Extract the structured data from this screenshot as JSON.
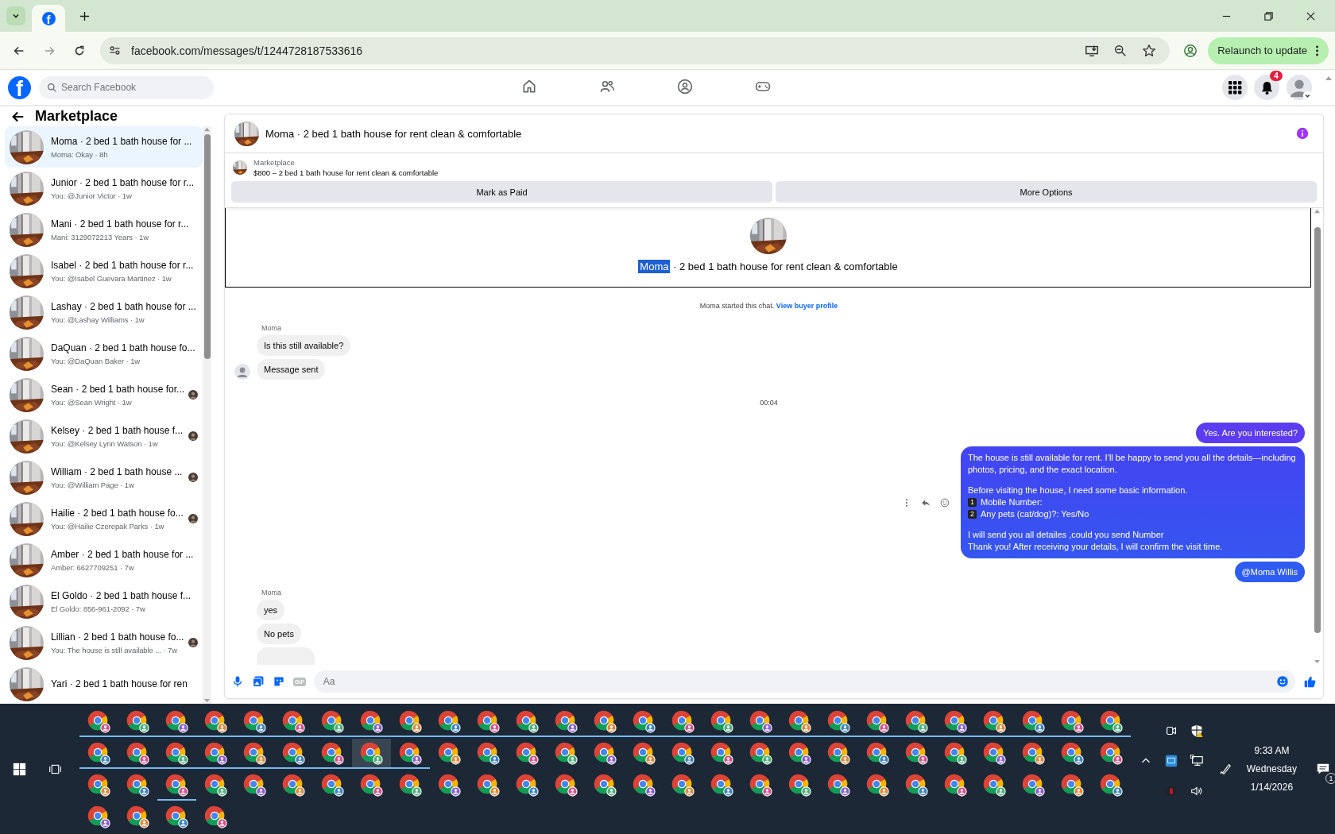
{
  "browser": {
    "favicon_letter": "f",
    "url": "facebook.com/messages/t/1244728187533616",
    "relaunch": "Relaunch to update"
  },
  "facebook": {
    "logo_letter": "f",
    "search": {
      "placeholder": "Search Facebook"
    },
    "nav": [
      {
        "selected": false
      },
      {
        "selected": false
      },
      {
        "selected": false
      },
      {
        "selected": false
      }
    ],
    "notifications": "4"
  },
  "sidebar": {
    "title": "Marketplace",
    "items": [
      {
        "title": "Moma · 2 bed 1 bath house for ...",
        "subtitle": "Moma: Okay · 8h",
        "selected": true,
        "seen": false
      },
      {
        "title": "Junior · 2 bed 1 bath house for r...",
        "subtitle": "You: @Junior Victor · 1w",
        "selected": false,
        "seen": false
      },
      {
        "title": "Mani · 2 bed 1 bath house for r...",
        "subtitle": "Mani: 3129072213 Years · 1w",
        "selected": false,
        "seen": false
      },
      {
        "title": "Isabel · 2 bed 1 bath house for r...",
        "subtitle": "You: @Isabel Guevara Martinez · 1w",
        "selected": false,
        "seen": false
      },
      {
        "title": "Lashay · 2 bed 1 bath house for ...",
        "subtitle": "You: @Lashay Williams · 1w",
        "selected": false,
        "seen": false
      },
      {
        "title": "DaQuan · 2 bed 1 bath house fo...",
        "subtitle": "You: @DaQuan Baker · 1w",
        "selected": false,
        "seen": false
      },
      {
        "title": "Sean · 2 bed 1 bath house for...",
        "subtitle": "You: @Sean Wright · 1w",
        "selected": false,
        "seen": true
      },
      {
        "title": "Kelsey · 2 bed 1 bath house f...",
        "subtitle": "You: @Kelsey Lynn Watson · 1w",
        "selected": false,
        "seen": true
      },
      {
        "title": "William · 2 bed 1 bath house ...",
        "subtitle": "You: @William Page · 1w",
        "selected": false,
        "seen": true
      },
      {
        "title": "Hailie · 2 bed 1 bath house fo...",
        "subtitle": "You: @Hailie Czerepak Parks · 1w",
        "selected": false,
        "seen": true
      },
      {
        "title": "Amber · 2 bed 1 bath house for ...",
        "subtitle": "Amber: 6627709251 · 7w",
        "selected": false,
        "seen": false
      },
      {
        "title": "El Goldo · 2 bed 1 bath house f...",
        "subtitle": "El Goldo: 856-961-2092 · 7w",
        "selected": false,
        "seen": false
      },
      {
        "title": "Lillian · 2 bed 1 bath house fo...",
        "subtitle": "You: The house is still available ... · 7w",
        "selected": false,
        "seen": true
      },
      {
        "title": "Yari · 2 bed 1 bath house for ren",
        "selected": false,
        "seen": false
      }
    ]
  },
  "chat": {
    "title": "Moma · 2 bed 1 bath house for rent clean & comfortable",
    "marketplace": {
      "label": "Marketplace",
      "listing": "$800 – 2 bed 1 bath house for rent clean & comfortable"
    },
    "buttons": [
      "Mark as Paid",
      "More Options"
    ],
    "intro_title": [
      {
        "text": "Moma",
        "selected": true
      },
      {
        "text": " · 2 bed 1 bath house for rent clean & comfortable",
        "selected": false
      }
    ],
    "started": "Moma started this chat.",
    "profile_link": "View buyer profile",
    "messages": [
      {
        "kind": "sender",
        "text": "Moma"
      },
      {
        "kind": "incoming",
        "text": "Is this still available?",
        "avatar": false
      },
      {
        "kind": "incoming",
        "text": "Message sent",
        "avatar": true
      },
      {
        "kind": "time",
        "text": "00:04"
      },
      {
        "kind": "outgoing",
        "text": "Yes. Are you interested?",
        "color": "#5b3cf0"
      },
      {
        "kind": "long",
        "color": "#4444f2",
        "paragraphs": [
          [
            {
              "text": "The house is still available for rent. I’ll be happy to send you all the details—including photos, pricing, and the exact location."
            }
          ],
          [
            {
              "text": "Before visiting the house, I need some basic information."
            },
            {
              "keycap": "1",
              "text": " Mobile Number:"
            },
            {
              "keycap": "2",
              "text": "Any pets (cat/dog)?: Yes/No"
            }
          ],
          [
            {
              "text": "I will send you all detailes ,could you send Number"
            },
            {
              "text": "Thank you! After receiving your details, I will confirm the visit time."
            }
          ]
        ]
      },
      {
        "kind": "outgoing",
        "text": "@Moma Willis",
        "color": "#2f5cf0"
      },
      {
        "kind": "sender",
        "text": "Moma"
      },
      {
        "kind": "incoming",
        "text": "yes",
        "avatar": false
      },
      {
        "kind": "incoming",
        "text": "No pets",
        "avatar": false
      },
      {
        "kind": "clipped"
      }
    ],
    "composer": {
      "gif": "GIF",
      "placeholder": "Aa"
    }
  },
  "taskbar": {
    "app_rows": [
      [
        {
          "running": true,
          "selected": false
        },
        {
          "running": true,
          "selected": false
        },
        {
          "running": true,
          "selected": false
        },
        {
          "running": true,
          "selected": false
        },
        {
          "running": true,
          "selected": false
        },
        {
          "running": true,
          "selected": false
        },
        {
          "running": true,
          "selected": false
        },
        {
          "running": true,
          "selected": false
        },
        {
          "running": true,
          "selected": false
        },
        {
          "running": true,
          "selected": false
        },
        {
          "running": true,
          "selected": false
        },
        {
          "running": true,
          "selected": false
        },
        {
          "running": true,
          "selected": false
        },
        {
          "running": true,
          "selected": false
        },
        {
          "running": true,
          "selected": false
        },
        {
          "running": true,
          "selected": false
        },
        {
          "running": true,
          "selected": false
        },
        {
          "running": true,
          "selected": false
        },
        {
          "running": true,
          "selected": false
        },
        {
          "running": true,
          "selected": false
        },
        {
          "running": true,
          "selected": false
        },
        {
          "running": true,
          "selected": false
        },
        {
          "running": true,
          "selected": false
        },
        {
          "running": true,
          "selected": false
        },
        {
          "running": true,
          "selected": false
        },
        {
          "running": true,
          "selected": false
        },
        {
          "running": true,
          "selected": false
        }
      ],
      [
        {
          "running": true,
          "selected": false
        },
        {
          "running": true,
          "selected": false
        },
        {
          "running": true,
          "selected": false
        },
        {
          "running": true,
          "selected": false
        },
        {
          "running": true,
          "selected": false
        },
        {
          "running": true,
          "selected": false
        },
        {
          "running": true,
          "selected": false
        },
        {
          "running": true,
          "selected": true
        },
        {
          "running": true,
          "selected": false
        },
        {
          "running": false,
          "selected": false
        },
        {
          "running": false,
          "selected": false
        },
        {
          "running": false,
          "selected": false
        },
        {
          "running": false,
          "selected": false
        },
        {
          "running": false,
          "selected": false
        },
        {
          "running": false,
          "selected": false
        },
        {
          "running": false,
          "selected": false
        },
        {
          "running": false,
          "selected": false
        },
        {
          "running": false,
          "selected": false
        },
        {
          "running": false,
          "selected": false
        },
        {
          "running": false,
          "selected": false
        },
        {
          "running": false,
          "selected": false
        },
        {
          "running": false,
          "selected": false
        },
        {
          "running": false,
          "selected": false
        },
        {
          "running": false,
          "selected": false
        },
        {
          "running": false,
          "selected": false
        },
        {
          "running": false,
          "selected": false
        },
        {
          "running": false,
          "selected": false
        }
      ],
      [
        {
          "running": false,
          "selected": false
        },
        {
          "running": false,
          "selected": false
        },
        {
          "running": true,
          "selected": false
        },
        {
          "running": false,
          "selected": false
        },
        {
          "running": false,
          "selected": false
        },
        {
          "running": false,
          "selected": false
        },
        {
          "running": false,
          "selected": false
        },
        {
          "running": false,
          "selected": false
        },
        {
          "running": false,
          "selected": false
        },
        {
          "running": false,
          "selected": false
        },
        {
          "running": false,
          "selected": false
        },
        {
          "running": false,
          "selected": false
        },
        {
          "running": false,
          "selected": false
        },
        {
          "running": false,
          "selected": false
        },
        {
          "running": false,
          "selected": false
        },
        {
          "running": false,
          "selected": false
        },
        {
          "running": false,
          "selected": false
        },
        {
          "running": false,
          "selected": false
        },
        {
          "running": false,
          "selected": false
        },
        {
          "running": false,
          "selected": false
        },
        {
          "running": false,
          "selected": false
        },
        {
          "running": false,
          "selected": false
        },
        {
          "running": false,
          "selected": false
        },
        {
          "running": false,
          "selected": false
        },
        {
          "running": false,
          "selected": false
        },
        {
          "running": false,
          "selected": false
        },
        {
          "running": false,
          "selected": false
        }
      ],
      [
        {
          "running": false,
          "selected": false
        },
        {
          "running": false,
          "selected": false
        },
        {
          "running": false,
          "selected": false
        },
        {
          "running": false,
          "selected": false
        }
      ]
    ],
    "time": "9:33 AM",
    "day": "Wednesday",
    "date": "1/14/2026",
    "notification_count": "1"
  }
}
